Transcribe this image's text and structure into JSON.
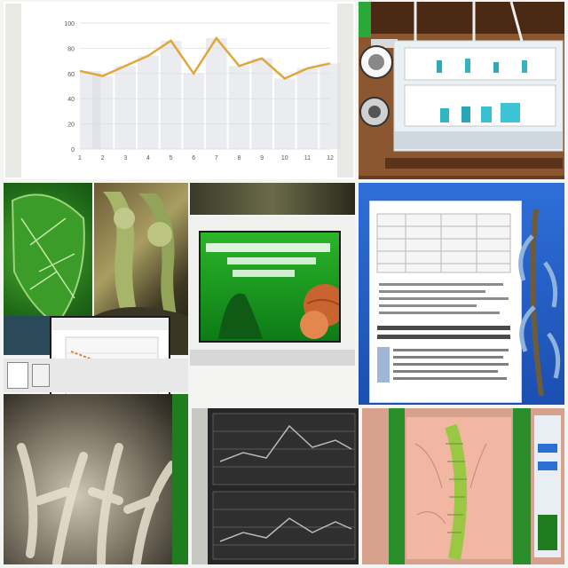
{
  "colors": {
    "page_bg": "#f4f4f2",
    "line_orange": "#e0a73a",
    "bar_gray": "#d9dde2",
    "green_panel": "#1f9e24",
    "blue_panel": "#2c67d3",
    "lab_wood": "#6a3b1f",
    "micro_pink": "#d7a28d"
  },
  "top_chart": {
    "title": "",
    "xlabel": "",
    "ylabel": ""
  },
  "chart_data": {
    "type": "line",
    "x": [
      1,
      2,
      3,
      4,
      5,
      6,
      7,
      8,
      9,
      10,
      11,
      12
    ],
    "series": [
      {
        "values": [
          62,
          58,
          66,
          74,
          86,
          60,
          88,
          66,
          72,
          56,
          64,
          68
        ]
      }
    ],
    "ylim": [
      0,
      100
    ],
    "grid": true
  },
  "green_slide": {
    "heading": "",
    "lines": []
  },
  "blue_doc": {
    "title": ""
  },
  "small_chart": {
    "title": ""
  },
  "icons": {
    "microscope": "microscope-icon",
    "leaf": "leaf-icon",
    "fungus": "fungus-icon",
    "coral": "coral-icon",
    "seed": "seed-icon"
  }
}
